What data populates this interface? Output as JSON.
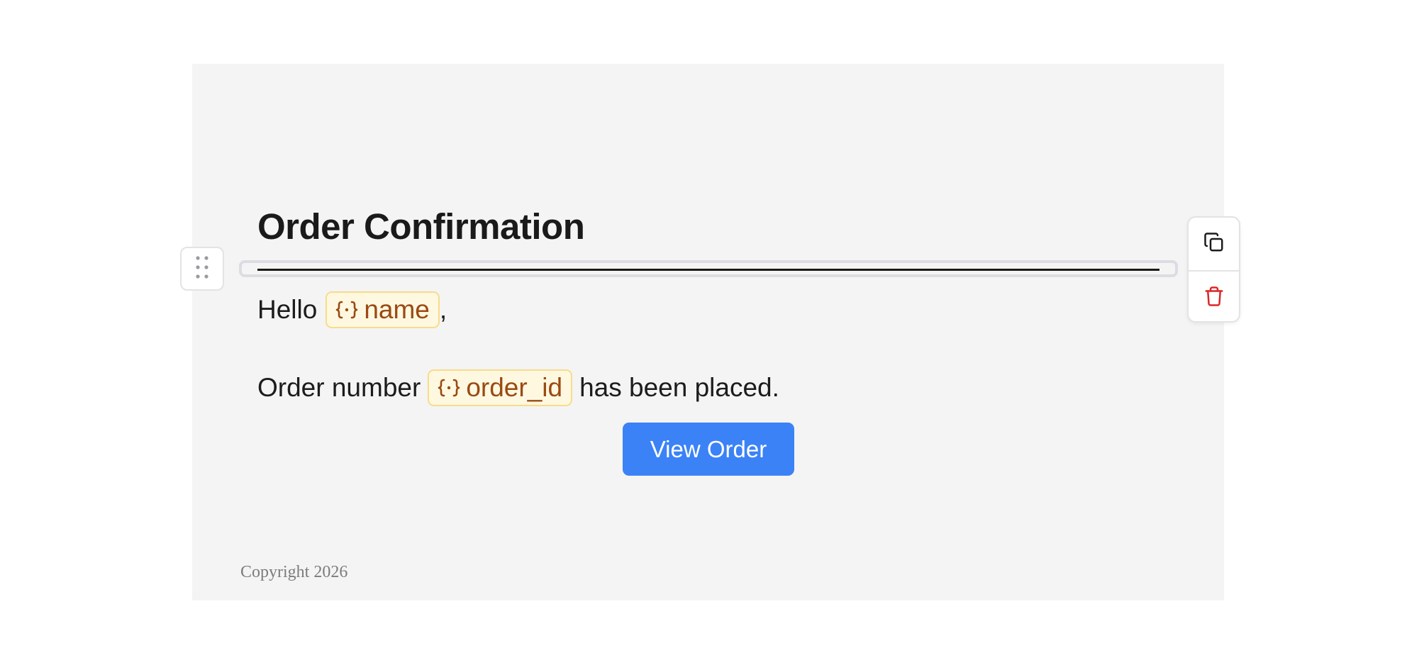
{
  "email": {
    "heading": "Order Confirmation",
    "greeting": {
      "prefix": "Hello",
      "variable": "name",
      "suffix": ","
    },
    "order_line": {
      "prefix": "Order number",
      "variable": "order_id",
      "suffix": "has been placed."
    },
    "button_label": "View Order",
    "footer": "Copyright 2026"
  },
  "block_toolbar": {
    "actions": [
      "duplicate-icon",
      "trash-icon"
    ]
  },
  "colors": {
    "accent": "#3b82f6",
    "variable_bg": "#fff8e1",
    "variable_text": "#9a4a12",
    "delete": "#dc2626",
    "canvas_bg": "#f4f4f4"
  }
}
